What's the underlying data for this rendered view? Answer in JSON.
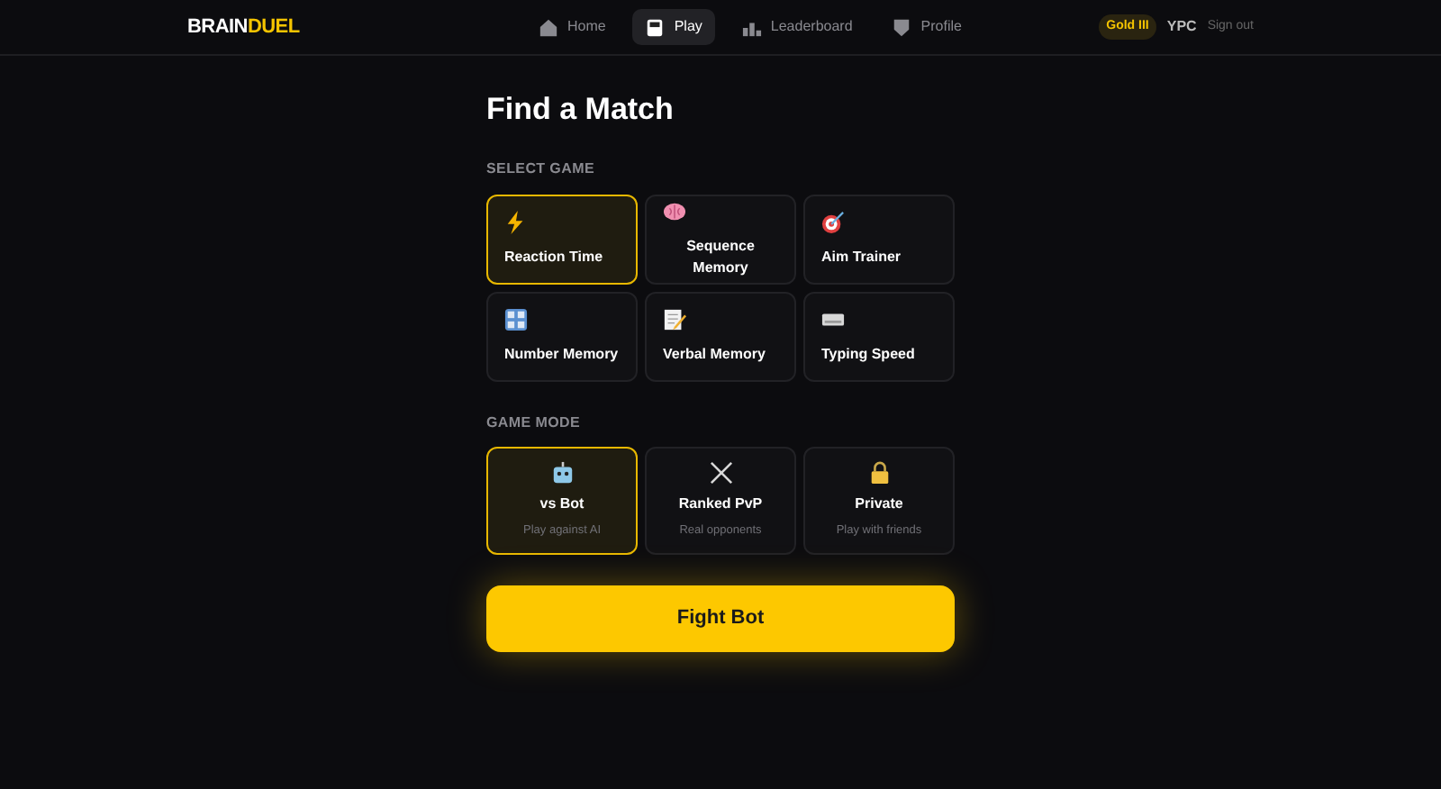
{
  "header": {
    "logo": {
      "first": "BRAIN",
      "second": "DUEL"
    },
    "nav": [
      {
        "label": "Home",
        "selected": false
      },
      {
        "label": "Play",
        "selected": true
      },
      {
        "label": "Leaderboard",
        "selected": false
      },
      {
        "label": "Profile",
        "selected": false
      }
    ],
    "rank_badge": "Gold III",
    "username": "YPC",
    "sign_out": "Sign out"
  },
  "title": "Find a Match",
  "games_heading": "SELECT GAME",
  "games": [
    {
      "label": "Reaction Time",
      "selected": true
    },
    {
      "label": "Sequence Memory",
      "selected": false
    },
    {
      "label": "Aim Trainer",
      "selected": false
    },
    {
      "label": "Number Memory",
      "selected": false
    },
    {
      "label": "Verbal Memory",
      "selected": false
    },
    {
      "label": "Typing Speed",
      "selected": false
    }
  ],
  "modes_heading": "GAME MODE",
  "modes": [
    {
      "label": "vs Bot",
      "description": "Play against AI",
      "selected": true
    },
    {
      "label": "Ranked PvP",
      "description": "Real opponents",
      "selected": false
    },
    {
      "label": "Private",
      "description": "Play with friends",
      "selected": false
    }
  ],
  "action_button": "Fight Bot"
}
